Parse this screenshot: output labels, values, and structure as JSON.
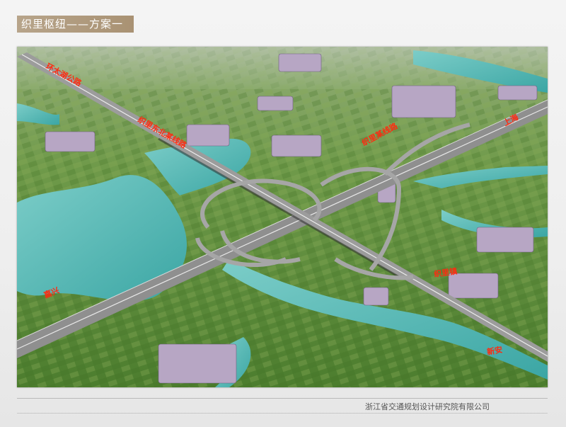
{
  "title": "织里枢纽——方案一",
  "institute": "浙江省交通规划设计研究院有限公司",
  "labels": {
    "top_left": "环太湖公路",
    "upper_left_road": "织里东北某线路",
    "upper_mid_road": "织里某线路",
    "right_top": "上海",
    "left_bottom": "嘉兴",
    "right_mid": "织里镇",
    "bottom_right": "新安"
  },
  "colors": {
    "title_bg": "#b0997c",
    "label_red": "#ff2a10",
    "water": "#4fb3b0",
    "field_green": "#5f8f3a",
    "road": "#9a9a9a"
  }
}
